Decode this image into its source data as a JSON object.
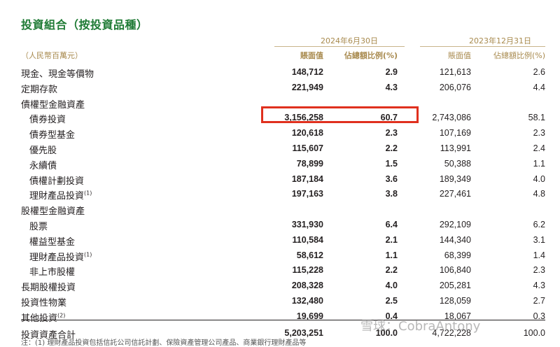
{
  "title": "投資組合（按投資品種）",
  "unit": "（人民幣百萬元）",
  "period_current": "2024年6月30日",
  "period_prior": "2023年12月31日",
  "col_carrying": "賬面值",
  "col_pct": "佔總額比例(%)",
  "rows": [
    {
      "label": "現金、現金等價物",
      "level": 0,
      "cur_val": "148,712",
      "cur_pct": "2.9",
      "prev_val": "121,613",
      "prev_pct": "2.6"
    },
    {
      "label": "定期存款",
      "level": 0,
      "cur_val": "221,949",
      "cur_pct": "4.3",
      "prev_val": "206,076",
      "prev_pct": "4.4"
    },
    {
      "label": "債權型金融資產",
      "level": 0,
      "cur_val": "",
      "cur_pct": "",
      "prev_val": "",
      "prev_pct": ""
    },
    {
      "label": "債券投資",
      "level": 1,
      "cur_val": "3,156,258",
      "cur_pct": "60.7",
      "prev_val": "2,743,086",
      "prev_pct": "58.1"
    },
    {
      "label": "債券型基金",
      "level": 1,
      "cur_val": "120,618",
      "cur_pct": "2.3",
      "prev_val": "107,169",
      "prev_pct": "2.3"
    },
    {
      "label": "優先股",
      "level": 1,
      "cur_val": "115,607",
      "cur_pct": "2.2",
      "prev_val": "113,991",
      "prev_pct": "2.4"
    },
    {
      "label": "永續債",
      "level": 1,
      "cur_val": "78,899",
      "cur_pct": "1.5",
      "prev_val": "50,388",
      "prev_pct": "1.1"
    },
    {
      "label": "債權計劃投資",
      "level": 1,
      "cur_val": "187,184",
      "cur_pct": "3.6",
      "prev_val": "189,349",
      "prev_pct": "4.0"
    },
    {
      "label": "理財產品投資",
      "note": "(1)",
      "level": 1,
      "cur_val": "197,163",
      "cur_pct": "3.8",
      "prev_val": "227,461",
      "prev_pct": "4.8"
    },
    {
      "label": "股權型金融資產",
      "level": 0,
      "cur_val": "",
      "cur_pct": "",
      "prev_val": "",
      "prev_pct": ""
    },
    {
      "label": "股票",
      "level": 1,
      "cur_val": "331,930",
      "cur_pct": "6.4",
      "prev_val": "292,109",
      "prev_pct": "6.2"
    },
    {
      "label": "權益型基金",
      "level": 1,
      "cur_val": "110,584",
      "cur_pct": "2.1",
      "prev_val": "144,340",
      "prev_pct": "3.1"
    },
    {
      "label": "理財產品投資",
      "note": "(1)",
      "level": 1,
      "cur_val": "58,612",
      "cur_pct": "1.1",
      "prev_val": "68,399",
      "prev_pct": "1.4"
    },
    {
      "label": "非上市股權",
      "level": 1,
      "cur_val": "115,228",
      "cur_pct": "2.2",
      "prev_val": "106,840",
      "prev_pct": "2.3"
    },
    {
      "label": "長期股權投資",
      "level": 0,
      "cur_val": "208,328",
      "cur_pct": "4.0",
      "prev_val": "205,281",
      "prev_pct": "4.3"
    },
    {
      "label": "投資性物業",
      "level": 0,
      "cur_val": "132,480",
      "cur_pct": "2.5",
      "prev_val": "128,059",
      "prev_pct": "2.7"
    },
    {
      "label": "其他投資",
      "note": "(2)",
      "level": 0,
      "cur_val": "19,699",
      "cur_pct": "0.4",
      "prev_val": "18,067",
      "prev_pct": "0.3"
    },
    {
      "label": "投資資產合計",
      "level": 0,
      "cur_val": "5,203,251",
      "cur_pct": "100.0",
      "prev_val": "4,722,228",
      "prev_pct": "100.0"
    }
  ],
  "watermark": "雪球：CobraAntony",
  "footnote": "注：(1) 理財產品投資包括信託公司信託計劃、保險資產管理公司產品、商業銀行理財產品等"
}
